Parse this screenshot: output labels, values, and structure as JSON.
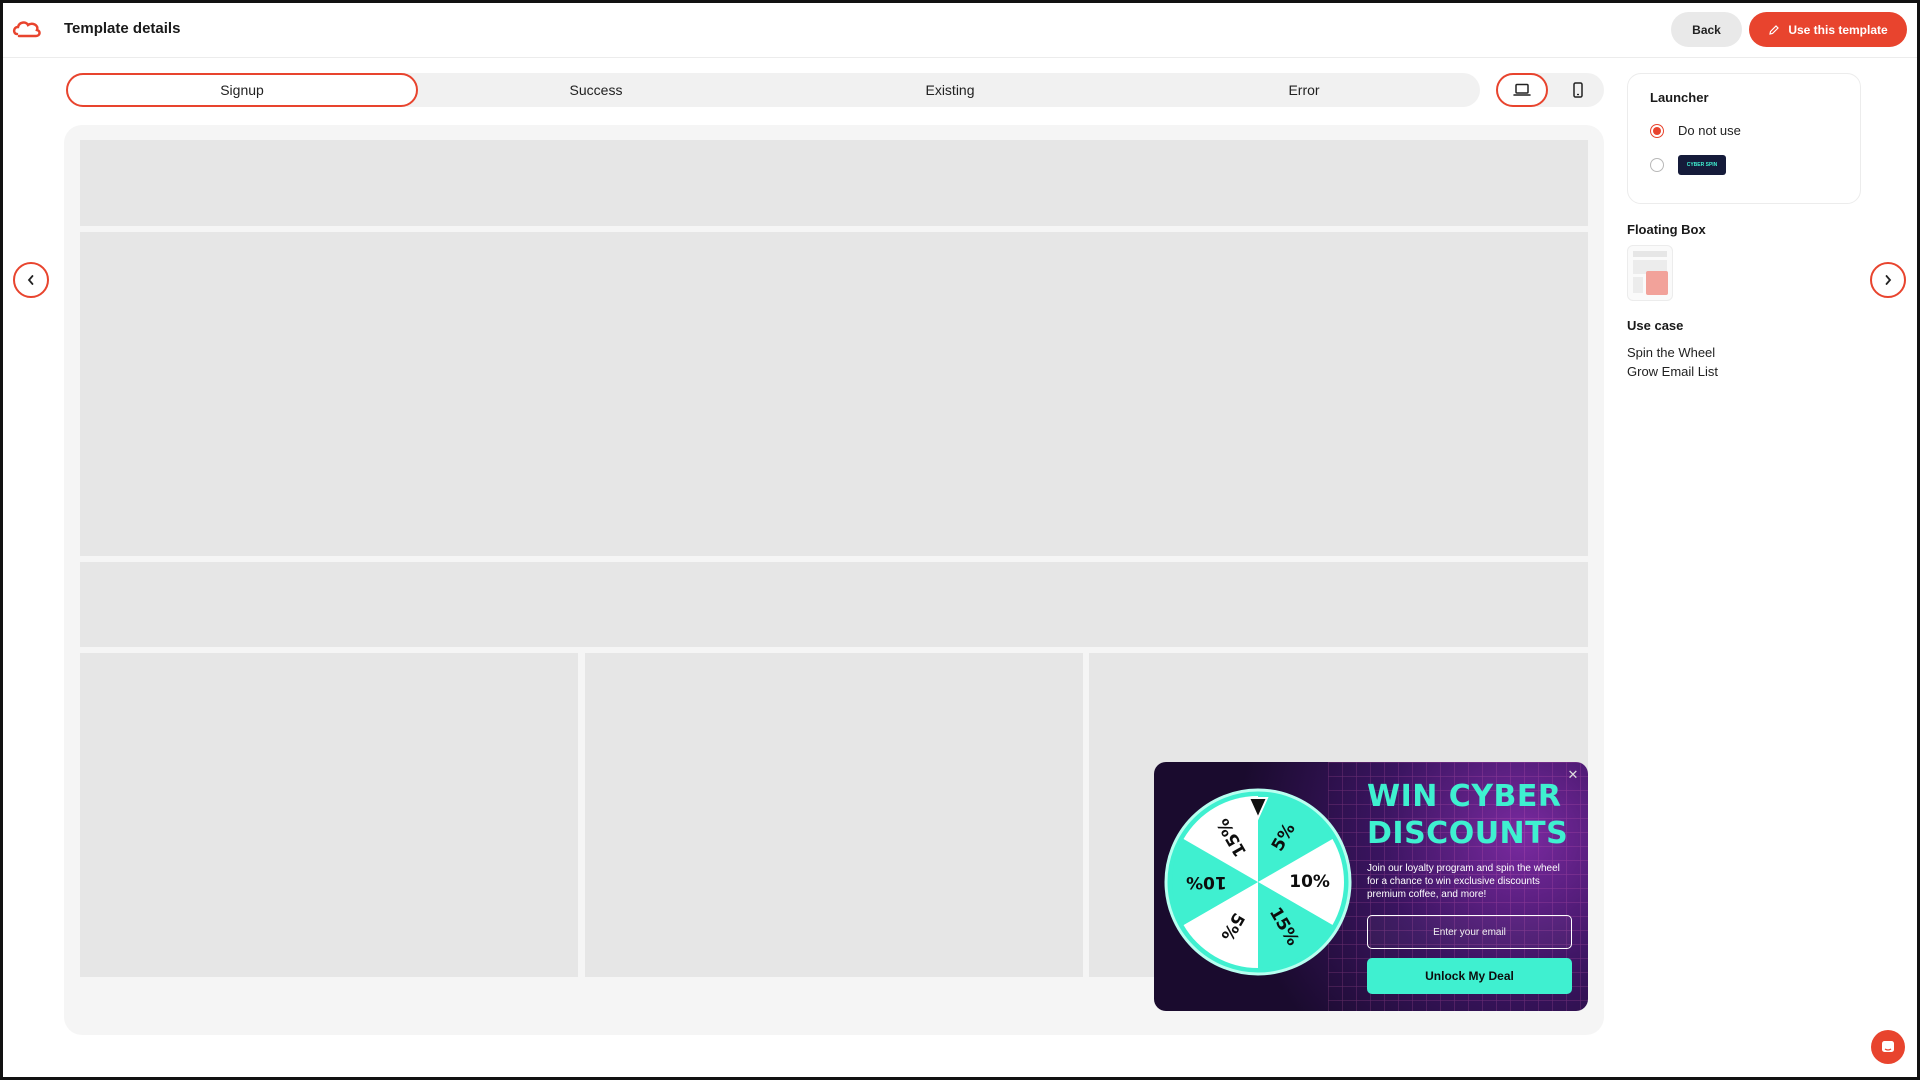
{
  "header": {
    "title": "Template details",
    "back_label": "Back",
    "use_template_label": "Use this template"
  },
  "tabs": [
    {
      "label": "Signup",
      "active": true
    },
    {
      "label": "Success",
      "active": false
    },
    {
      "label": "Existing",
      "active": false
    },
    {
      "label": "Error",
      "active": false
    }
  ],
  "device_toggle": {
    "selected": "desktop",
    "options": [
      "desktop-icon",
      "mobile-icon"
    ]
  },
  "right_panel": {
    "launcher": {
      "title": "Launcher",
      "options": [
        {
          "label": "Do not use",
          "selected": true
        },
        {
          "label": "",
          "thumbnail_text": "CYBER SPIN",
          "selected": false
        }
      ]
    },
    "floating_box_title": "Floating Box",
    "use_case": {
      "title": "Use case",
      "items": [
        "Spin the Wheel",
        "Grow Email List"
      ]
    }
  },
  "popup": {
    "title_line1": "WIN CYBER",
    "title_line2": "DISCOUNTS",
    "description": "Join our loyalty program and spin the wheel for a chance to win exclusive discounts premium coffee, and more!",
    "email_placeholder": "Enter your email",
    "cta_label": "Unlock My Deal",
    "wheel_segments": [
      "5%",
      "10%",
      "15%",
      "5%",
      "10%",
      "15%"
    ]
  },
  "colors": {
    "accent": "#e8442e",
    "popup_accent": "#3ff0d0",
    "popup_bg": "#1a0b2e",
    "placeholder_block": "#e6e6e6"
  }
}
